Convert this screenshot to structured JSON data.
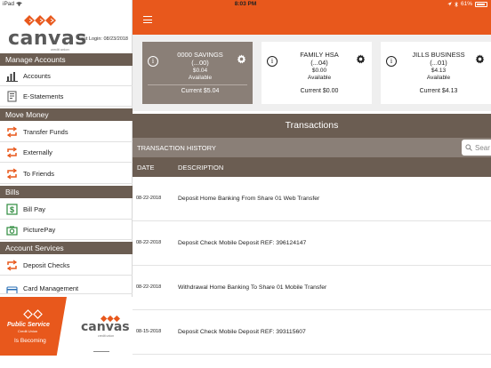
{
  "status_bar": {
    "carrier": "iPad",
    "time": "8:03 PM",
    "battery": "61%"
  },
  "brand": {
    "name": "canvas",
    "sub": "credit union",
    "last_login_label": "Last Login:",
    "last_login_date": "08/23/2018"
  },
  "sidebar": {
    "sections": [
      {
        "title": "Manage Accounts"
      },
      {
        "title": "Move Money"
      },
      {
        "title": "Bills"
      },
      {
        "title": "Account Services"
      }
    ],
    "items": [
      {
        "label": "Accounts",
        "icon": "bar-chart-icon"
      },
      {
        "label": "E-Statements",
        "icon": "document-icon"
      },
      {
        "label": "Transfer Funds",
        "icon": "transfer-arrows-icon"
      },
      {
        "label": "Externally",
        "icon": "transfer-arrows-icon"
      },
      {
        "label": "To Friends",
        "icon": "transfer-arrows-icon"
      },
      {
        "label": "Bill Pay",
        "icon": "dollar-bill-icon"
      },
      {
        "label": "PicturePay",
        "icon": "camera-icon"
      },
      {
        "label": "Deposit Checks",
        "icon": "transfer-arrows-icon"
      },
      {
        "label": "Card Management",
        "icon": "card-icon"
      }
    ]
  },
  "promo": {
    "ps_title": "Public Service",
    "ps_sub": "Credit Union",
    "becoming": "Is Becoming",
    "canvas": "canvas",
    "canvas_sub": "credit union"
  },
  "accounts": [
    {
      "name": "0000 SAVINGS",
      "number": "(...00)",
      "amount": "$0.04",
      "available_label": "Available",
      "current": "Current $5.04",
      "selected": true
    },
    {
      "name": "FAMILY HSA",
      "number": "(...04)",
      "amount": "$0.00",
      "available_label": "Available",
      "current": "Current $0.00",
      "selected": false
    },
    {
      "name": "JILLS BUSINESS",
      "number": "(...01)",
      "amount": "$4.13",
      "available_label": "Available",
      "current": "Current $4.13",
      "selected": false
    }
  ],
  "transactions": {
    "title": "Transactions",
    "history_label": "TRANSACTION HISTORY",
    "search_placeholder": "Sear",
    "col_date": "DATE",
    "col_desc": "DESCRIPTION",
    "rows": [
      {
        "date": "08-22-2018",
        "description": "Deposit Home Banking From Share 01 Web Transfer"
      },
      {
        "date": "08-22-2018",
        "description": "Deposit Check Mobile Deposit REF: 396124147"
      },
      {
        "date": "08-22-2018",
        "description": "Withdrawal Home Banking To Share 01 Mobile Transfer"
      },
      {
        "date": "08-15-2018",
        "description": "Deposit Check Mobile Deposit REF: 393115607"
      }
    ]
  },
  "colors": {
    "accent": "#e8581c",
    "brown": "#6b5d52",
    "taupe": "#8a7f77"
  }
}
